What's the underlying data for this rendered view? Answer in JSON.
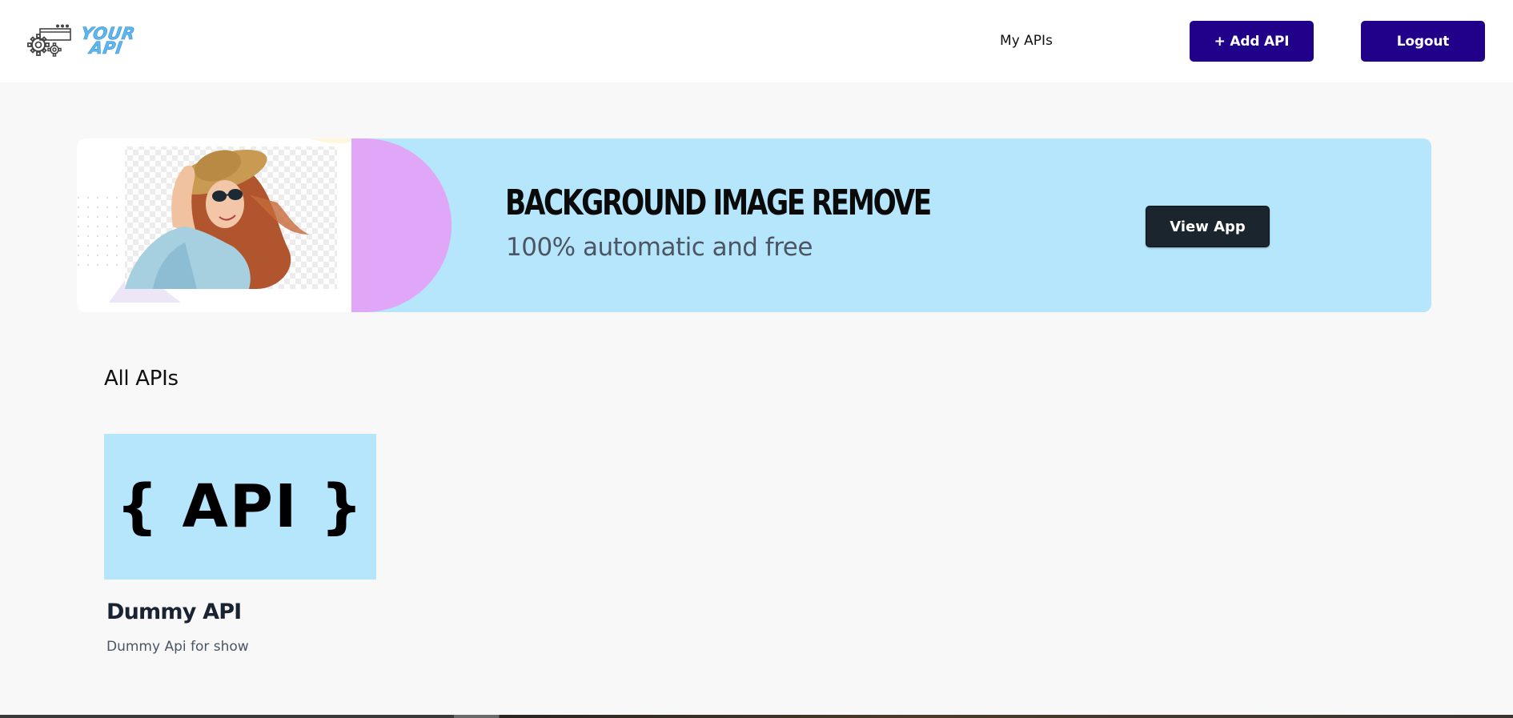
{
  "header": {
    "logo": {
      "line1": "YOUR",
      "line2": "API",
      "icon": "gear-window-icon"
    },
    "nav": {
      "my_apis": "My APIs"
    },
    "buttons": {
      "add_api": "+ Add API",
      "logout": "Logout"
    }
  },
  "banner": {
    "title": "BACKGROUND IMAGE REMOVE",
    "subtitle": "100% automatic and free",
    "view_app": "View App",
    "photo_icon": "woman-with-sunhat-photo"
  },
  "section": {
    "title": "All APIs"
  },
  "apis": [
    {
      "image_text": "{ API }",
      "name": "Dummy API",
      "description": "Dummy Api for show"
    }
  ],
  "colors": {
    "primary_button": "#21008a",
    "banner_bg": "#b6e6fb",
    "banner_accent": "#e0a6f7",
    "view_button": "#1b252d",
    "page_bg": "#f8f8f8"
  }
}
